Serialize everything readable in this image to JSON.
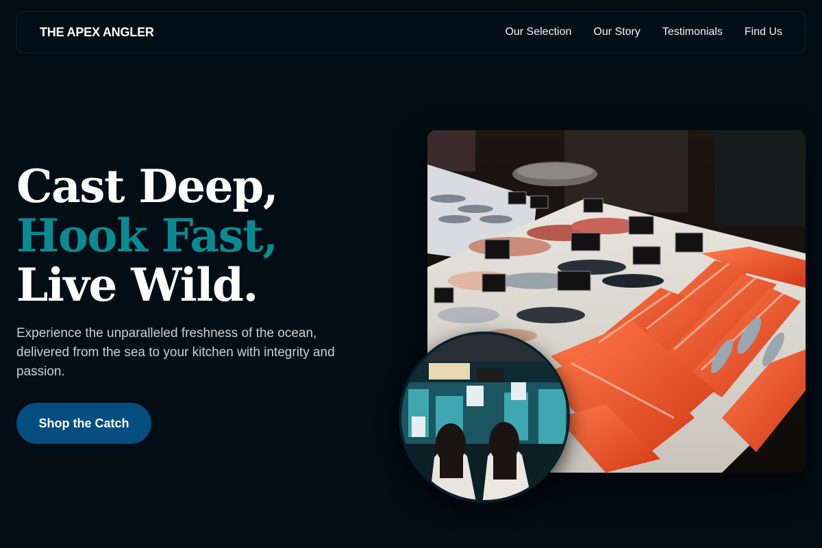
{
  "nav": {
    "brand": "THE APEX ANGLER",
    "links": [
      "Our Selection",
      "Our Story",
      "Testimonials",
      "Find Us"
    ]
  },
  "hero": {
    "headline_line1": "Cast Deep,",
    "headline_line2": "Hook Fast,",
    "headline_line3": "Live Wild.",
    "subtitle": "Experience the unparalleled freshness of the ocean, delivered from the sea to your kitchen with integrity and passion.",
    "cta_label": "Shop the Catch"
  },
  "colors": {
    "background": "#020d15",
    "accent": "#0b8a93",
    "button": "#064e80"
  }
}
